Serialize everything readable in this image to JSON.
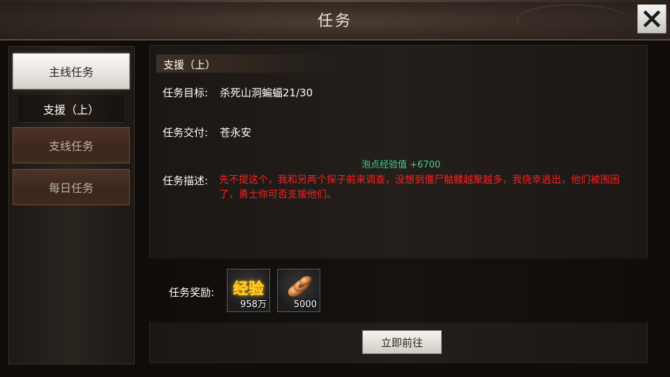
{
  "header": {
    "title": "任务"
  },
  "sidebar": {
    "tabs": [
      {
        "label": "主线任务",
        "state": "active"
      },
      {
        "label": "支线任务",
        "state": "inactive"
      },
      {
        "label": "每日任务",
        "state": "inactive"
      }
    ],
    "active_quest": "支援（上）"
  },
  "quest": {
    "title": "支援（上）",
    "objective_label": "任务目标:",
    "objective_value": "杀死山洞蝙蝠21/30",
    "turn_in_label": "任务交付:",
    "turn_in_value": "苍永安",
    "exp_bonus": "泡点经验值 +6700",
    "description_label": "任务描述:",
    "description": "先不提这个，我和另两个探子前来调查，没想到僵尸骷髅越聚越多，我侥幸逃出，他们被围困了，勇士你可否支援他们。"
  },
  "rewards": {
    "label": "任务奖励:",
    "items": [
      {
        "name": "经验",
        "icon": "exp-icon",
        "count": "958万"
      },
      {
        "icon": "coin-icon",
        "count": "5000"
      }
    ]
  },
  "actions": {
    "go_label": "立即前往"
  },
  "colors": {
    "description_text": "#ff1e1e",
    "exp_bonus_text": "#3fd18a",
    "exp_glyph": "#ffd21c"
  }
}
